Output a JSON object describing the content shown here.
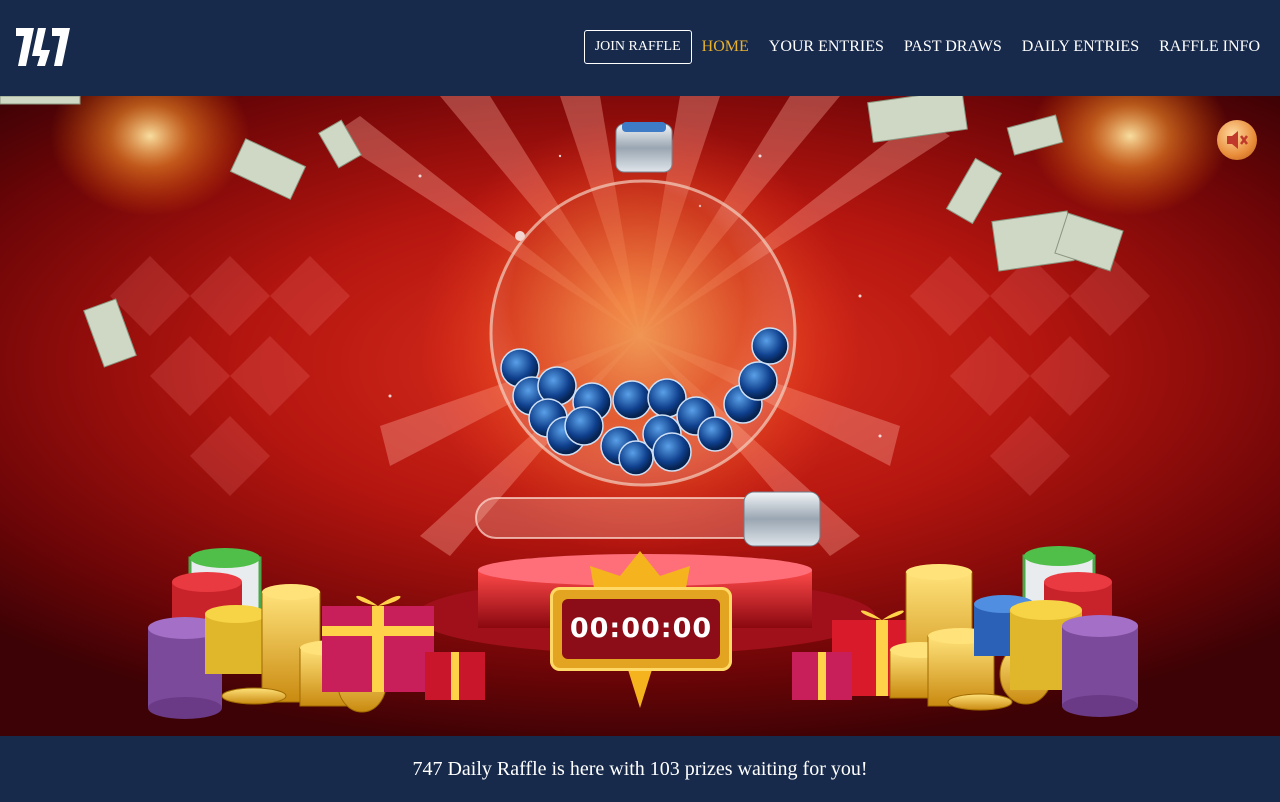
{
  "header": {
    "logo_text": "747",
    "join_label": "JOIN RAFFLE",
    "nav": [
      {
        "label": "HOME",
        "active": true
      },
      {
        "label": "YOUR ENTRIES"
      },
      {
        "label": "PAST DRAWS"
      },
      {
        "label": "DAILY ENTRIES"
      },
      {
        "label": "RAFFLE INFO"
      }
    ]
  },
  "hero": {
    "timer": "00:00:00",
    "mute_icon": "speaker-muted-icon"
  },
  "footer": {
    "message": "747 Daily Raffle is here with 103 prizes waiting for you!"
  },
  "colors": {
    "header_bg": "#172a4c",
    "active_nav": "#e9b12c",
    "hero_red": "#b3150f",
    "timer_frame": "#e3a521",
    "timer_bg": "#8c0d18"
  }
}
